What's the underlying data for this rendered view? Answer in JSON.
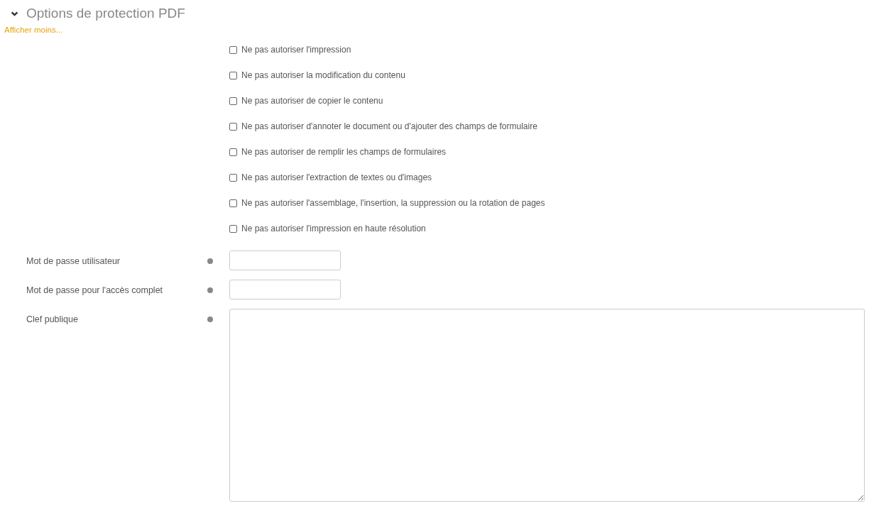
{
  "section": {
    "title": "Options de protection PDF",
    "expanded": true
  },
  "toggle_link": "Afficher moins...",
  "checkboxes": [
    {
      "label": "Ne pas autoriser l'impression",
      "checked": false
    },
    {
      "label": "Ne pas autoriser la modification du contenu",
      "checked": false
    },
    {
      "label": "Ne pas autoriser de copier le contenu",
      "checked": false
    },
    {
      "label": "Ne pas autoriser d'annoter le document ou d'ajouter des champs de formulaire",
      "checked": false
    },
    {
      "label": "Ne pas autoriser de remplir les champs de formulaires",
      "checked": false
    },
    {
      "label": "Ne pas autoriser l'extraction de textes ou d'images",
      "checked": false
    },
    {
      "label": "Ne pas autoriser l'assemblage, l'insertion, la suppression ou la rotation de pages",
      "checked": false
    },
    {
      "label": "Ne pas autoriser l'impression en haute résolution",
      "checked": false
    }
  ],
  "fields": [
    {
      "label": "Mot de passe utilisateur",
      "kind": "text"
    },
    {
      "label": "Mot de passe pour l'accès complet",
      "kind": "text"
    },
    {
      "label": "Clef publique",
      "kind": "textarea"
    }
  ]
}
